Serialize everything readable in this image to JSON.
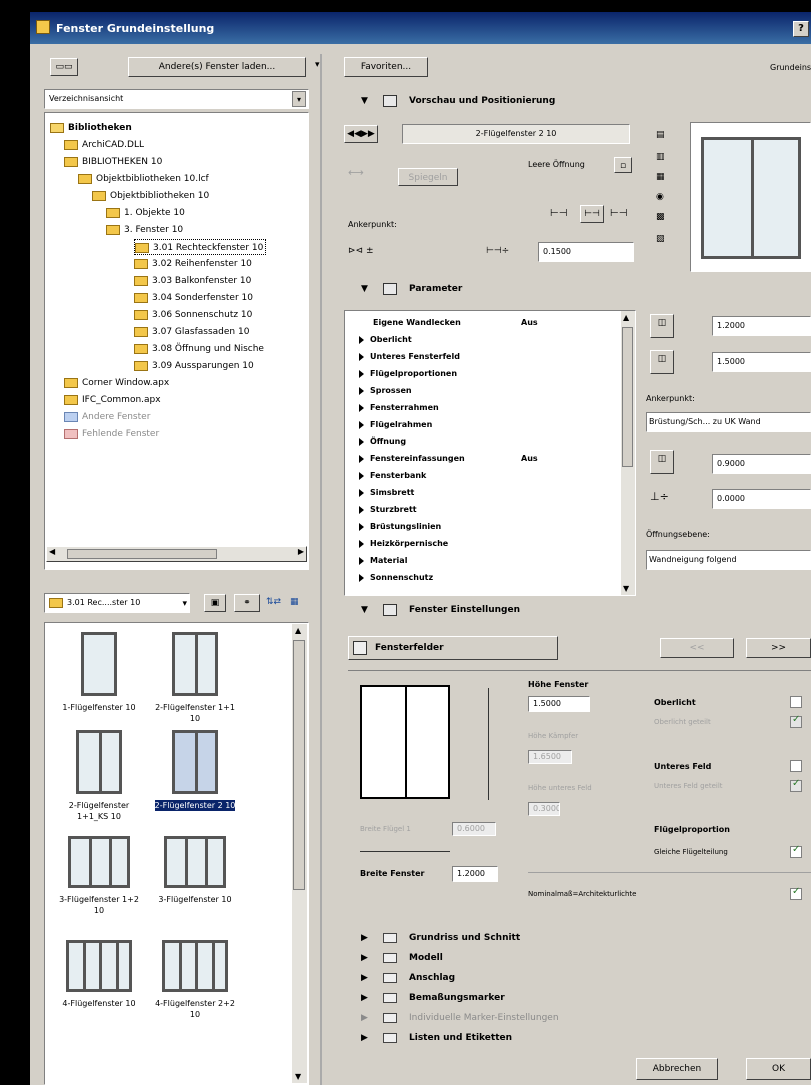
{
  "window": {
    "title": "Fenster Grundeinstellung",
    "help": "?"
  },
  "left": {
    "load_button": "Andere(s) Fenster laden...",
    "view_select": "Verzeichnisansicht",
    "tree": [
      {
        "label": "Bibliotheken",
        "bold": true
      },
      {
        "label": "ArchiCAD.DLL"
      },
      {
        "label": "BIBLIOTHEKEN 10"
      },
      {
        "label": "Objektbibliotheken 10.lcf"
      },
      {
        "label": "Objektbibliotheken 10"
      },
      {
        "label": "1. Objekte 10"
      },
      {
        "label": "3. Fenster 10"
      },
      {
        "label": "3.01 Rechteckfenster 10"
      },
      {
        "label": "3.02 Reihenfenster 10"
      },
      {
        "label": "3.03 Balkonfenster 10"
      },
      {
        "label": "3.04 Sonderfenster 10"
      },
      {
        "label": "3.06 Sonnenschutz 10"
      },
      {
        "label": "3.07 Glasfassaden 10"
      },
      {
        "label": "3.08 Öffnung und Nische"
      },
      {
        "label": "3.09 Aussparungen 10"
      },
      {
        "label": "Corner Window.apx"
      },
      {
        "label": "IFC_Common.apx"
      },
      {
        "label": "Andere Fenster"
      },
      {
        "label": "Fehlende Fenster"
      }
    ],
    "folder_select": "3.01 Rec....ster 10",
    "thumbnails": [
      {
        "label": "1-Flügelfenster 10"
      },
      {
        "label": "2-Flügelfenster 1+1 10"
      },
      {
        "label": "2-Flügelfenster 1+1_KS 10"
      },
      {
        "label": "2-Flügelfenster 2 10"
      },
      {
        "label": "3-Flügelfenster 1+2 10"
      },
      {
        "label": "3-Flügelfenster 10"
      },
      {
        "label": "4-Flügelfenster 10"
      },
      {
        "label": "4-Flügelfenster 2+2 10"
      }
    ]
  },
  "right": {
    "favorites_button": "Favoriten...",
    "grundeinst": "Grundeinst",
    "preview": {
      "title": "Vorschau und Positionierung",
      "object_name": "2-Flügelfenster 2 10",
      "leere_oeffnung": "Leere Öffnung",
      "spiegeln": "Spiegeln",
      "ankerpunkt": "Ankerpunkt:",
      "offset": "0.1500"
    },
    "parameter": {
      "title": "Parameter",
      "items": [
        {
          "name": "Eigene Wandlecken",
          "value": "Aus"
        },
        {
          "name": "Oberlicht",
          "value": ""
        },
        {
          "name": "Unteres Fensterfeld",
          "value": ""
        },
        {
          "name": "Flügelproportionen",
          "value": ""
        },
        {
          "name": "Sprossen",
          "value": ""
        },
        {
          "name": "Fensterrahmen",
          "value": ""
        },
        {
          "name": "Flügelrahmen",
          "value": ""
        },
        {
          "name": "Öffnung",
          "value": ""
        },
        {
          "name": "Fenstereinfassungen",
          "value": "Aus"
        },
        {
          "name": "Fensterbank",
          "value": ""
        },
        {
          "name": "Simsbrett",
          "value": ""
        },
        {
          "name": "Sturzbrett",
          "value": ""
        },
        {
          "name": "Brüstungslinien",
          "value": ""
        },
        {
          "name": "Heizkörpernische",
          "value": ""
        },
        {
          "name": "Material",
          "value": ""
        },
        {
          "name": "Sonnenschutz",
          "value": ""
        }
      ],
      "width": "1.2000",
      "height": "1.5000",
      "ankerpunkt_label": "Ankerpunkt:",
      "anker_select": "Brüstung/Sch... zu UK Wand",
      "brustung": "0.9000",
      "z": "0.0000",
      "ebene_label": "Öffnungsebene:",
      "ebene_select": "Wandneigung folgend"
    },
    "settings": {
      "title": "Fenster Einstellungen",
      "dropdown": "Fensterfelder",
      "prev": "<<",
      "next": ">>",
      "hoehe_fenster_label": "Höhe Fenster",
      "hoehe_fenster": "1.5000",
      "hoehe_kaempfer_label": "Höhe Kämpfer",
      "hoehe_kaempfer": "1.6500",
      "hoehe_unteres_label": "Höhe unteres Feld",
      "hoehe_unteres": "0.3000",
      "breite_fluegel_label": "Breite Flügel 1",
      "breite_fluegel": "0.6000",
      "breite_fenster_label": "Breite Fenster",
      "breite_fenster": "1.2000",
      "oberlicht": "Oberlicht",
      "oberlicht_geteilt": "Oberlicht geteilt",
      "unteres_feld": "Unteres Feld",
      "unteres_feld_geteilt": "Unteres Feld geteilt",
      "fluegelproportion": "Flügelproportion",
      "gleiche": "Gleiche Flügelteilung",
      "nominal": "Nominalmaß=Architekturlichte"
    },
    "collapsed": [
      {
        "label": "Grundriss und Schnitt"
      },
      {
        "label": "Modell"
      },
      {
        "label": "Anschlag"
      },
      {
        "label": "Bemaßungsmarker"
      },
      {
        "label": "Individuelle Marker-Einstellungen"
      },
      {
        "label": "Listen und Etiketten"
      }
    ],
    "cancel": "Abbrechen",
    "ok": "OK"
  }
}
